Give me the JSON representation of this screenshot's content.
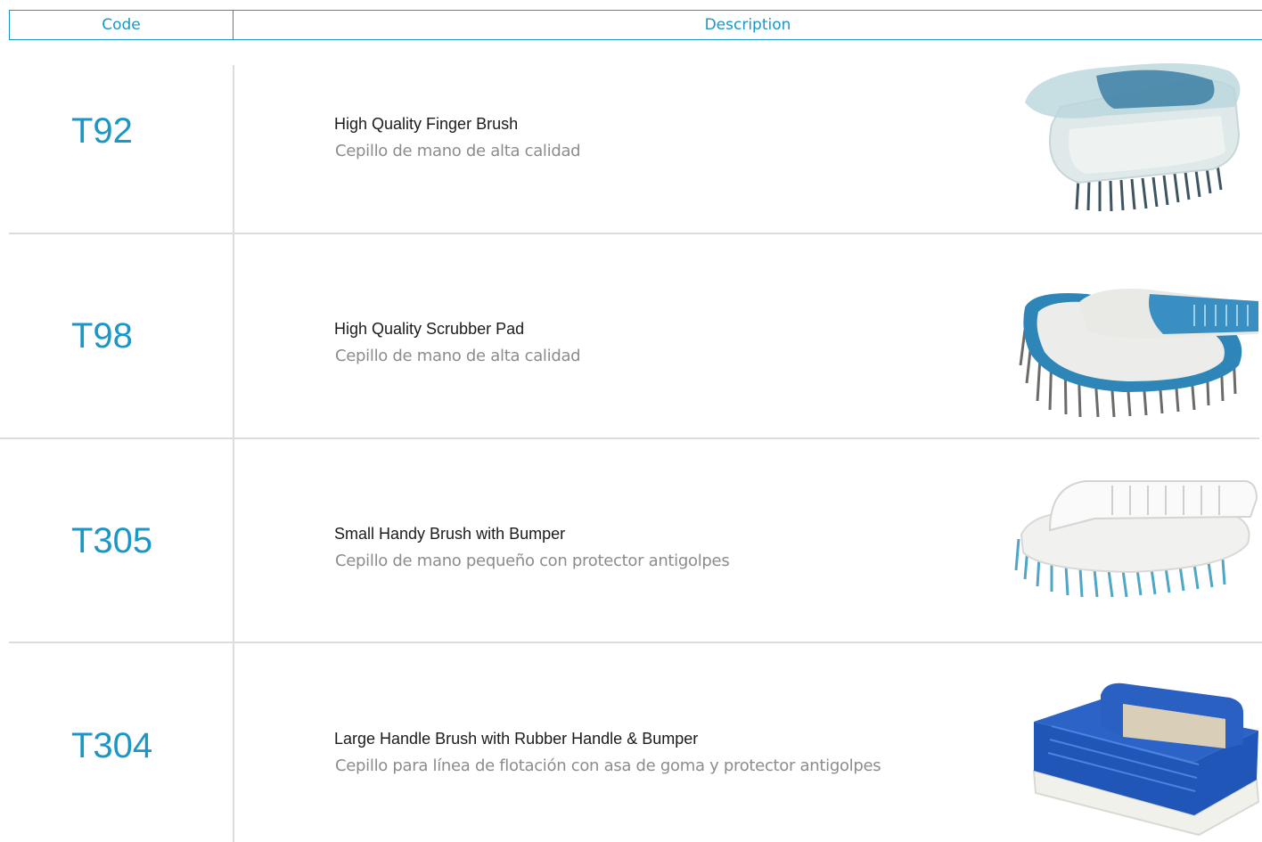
{
  "header": {
    "code_label": "Code",
    "description_label": "Description"
  },
  "products": [
    {
      "code": "T92",
      "title": "High Quality Finger Brush",
      "subtitle": "Cepillo de mano de alta calidad",
      "image_icon": "finger-brush-image"
    },
    {
      "code": "T98",
      "title": "High Quality Scrubber Pad",
      "subtitle": "Cepillo de mano de alta calidad",
      "image_icon": "scrubber-pad-image"
    },
    {
      "code": "T305",
      "title": "Small Handy Brush with Bumper",
      "subtitle": "Cepillo de mano pequeño con protector antigolpes",
      "image_icon": "handy-brush-image"
    },
    {
      "code": "T304",
      "title": "Large Handle Brush with Rubber Handle & Bumper",
      "subtitle": "Cepillo para línea de flotación con asa de goma y protector antigolpes",
      "image_icon": "handle-brush-image"
    }
  ],
  "colors": {
    "accent": "#1a96c8",
    "divider": "#dcdcdc",
    "title": "#1b1b1b",
    "subtitle": "#8c8c8c"
  }
}
